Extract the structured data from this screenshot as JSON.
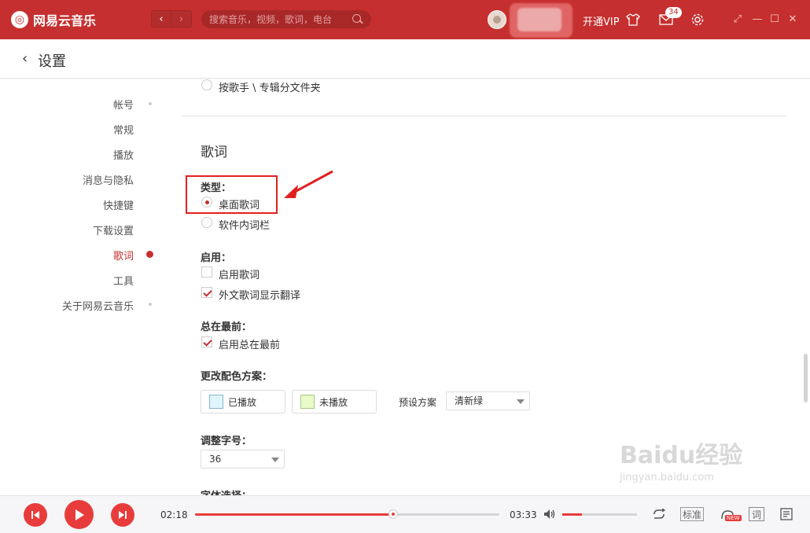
{
  "app": {
    "name": "网易云音乐",
    "logo_glyph": "◎"
  },
  "topbar": {
    "search_placeholder": "搜索音乐，视频，歌词，电台",
    "vip_label": "开通VIP",
    "mail_count": "34",
    "icons": [
      "back-icon",
      "forward-icon",
      "search-icon",
      "skin-icon",
      "mail-icon",
      "gear-icon",
      "mini-mode-icon",
      "minimize-icon",
      "maximize-icon",
      "close-icon"
    ]
  },
  "page": {
    "title": "设置",
    "back_glyph": "‹"
  },
  "sidebar": {
    "items": [
      {
        "label": "帐号"
      },
      {
        "label": "常规"
      },
      {
        "label": "播放"
      },
      {
        "label": "消息与隐私"
      },
      {
        "label": "快捷键"
      },
      {
        "label": "下载设置"
      },
      {
        "label": "歌词",
        "active": true
      },
      {
        "label": "工具"
      },
      {
        "label": "关于网易云音乐"
      }
    ]
  },
  "content": {
    "prev_option": "按歌手 \\ 专辑分文件夹",
    "section_title": "歌词",
    "type_title": "类型：",
    "type_options": [
      {
        "label": "桌面歌词",
        "selected": true
      },
      {
        "label": "软件内词栏",
        "selected": false
      }
    ],
    "enable_title": "启用：",
    "enable_options": [
      {
        "label": "启用歌词",
        "checked": false
      },
      {
        "label": "外文歌词显示翻译",
        "checked": true
      }
    ],
    "ontop_title": "总在最前：",
    "ontop_options": [
      {
        "label": "启用总在最前",
        "checked": true
      }
    ],
    "color_title": "更改配色方案：",
    "color_played": {
      "label": "已播放",
      "color": "#dff4fb"
    },
    "color_unplayed": {
      "label": "未播放",
      "color": "#e9fbc9"
    },
    "preset_label": "预设方案",
    "preset_value": "清新绿",
    "fontsize_title": "调整字号：",
    "fontsize_value": "36",
    "font_title": "字体选择："
  },
  "player": {
    "current_time": "02:18",
    "total_time": "03:33",
    "progress": 0.65,
    "volume": 0.26,
    "quality_label": "标准",
    "new_badge": "NEW",
    "lyric_label": "词"
  },
  "watermark": {
    "text": "Baidu经验",
    "sub": "jingyan.baidu.com"
  },
  "accent_color": "#c62f2f"
}
